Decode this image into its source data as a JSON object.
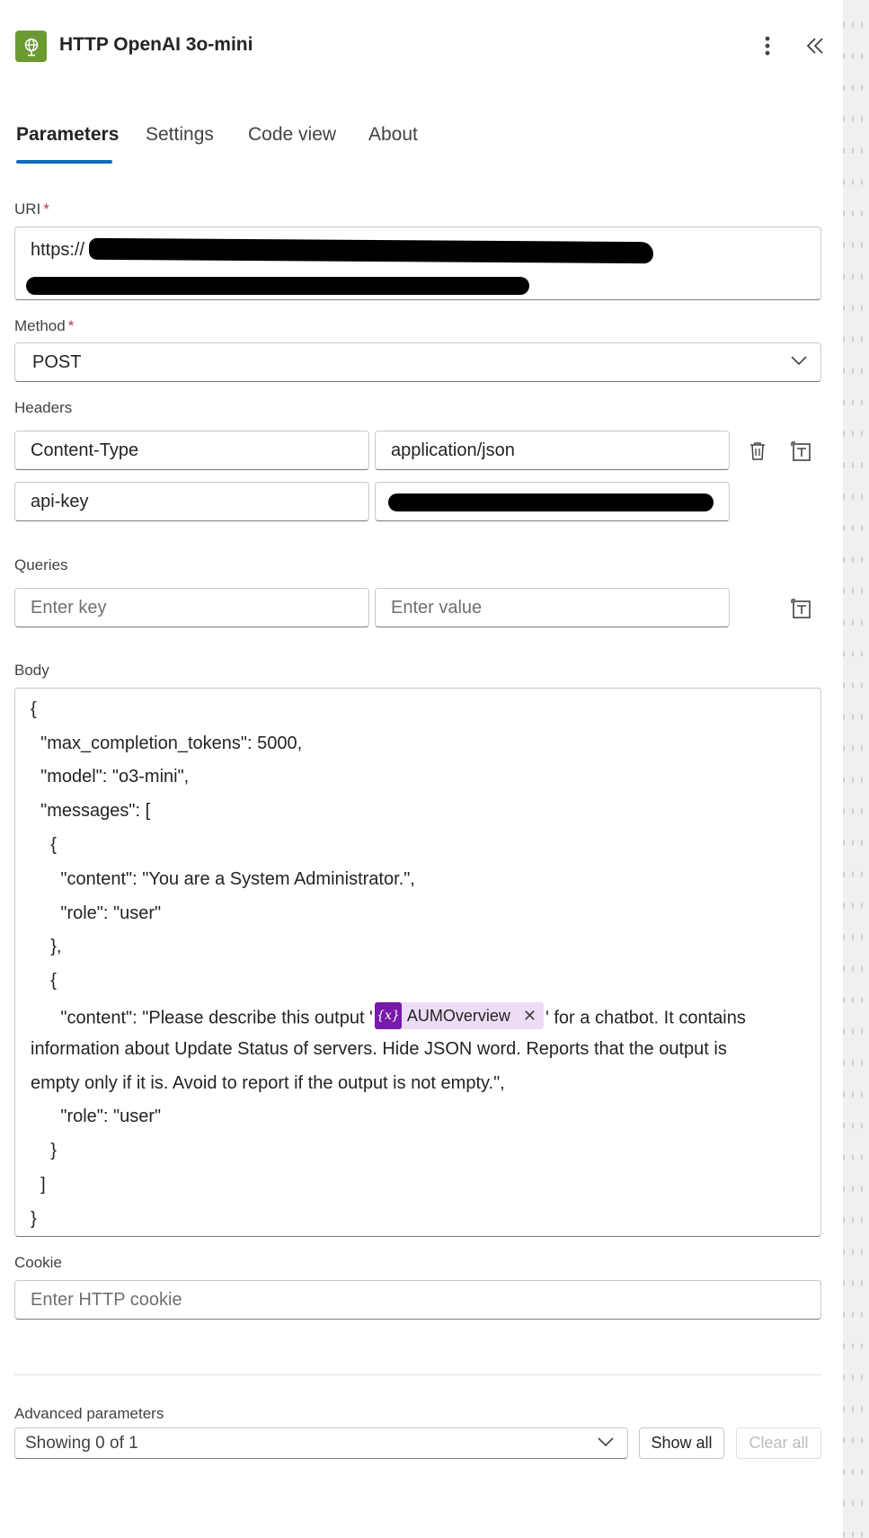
{
  "header": {
    "title": "HTTP OpenAI 3o-mini",
    "app_icon": "globe-icon",
    "app_icon_color": "#6b9a32"
  },
  "tabs": [
    {
      "label": "Parameters",
      "active": true
    },
    {
      "label": "Settings",
      "active": false
    },
    {
      "label": "Code view",
      "active": false
    },
    {
      "label": "About",
      "active": false
    }
  ],
  "uri": {
    "label": "URI",
    "required": "*",
    "value_visible_start": "https://"
  },
  "method": {
    "label": "Method",
    "required": "*",
    "value": "POST"
  },
  "headers": {
    "label": "Headers",
    "rows": [
      {
        "key": "Content-Type",
        "value": "application/json"
      },
      {
        "key": "api-key",
        "value": ""
      }
    ]
  },
  "queries": {
    "label": "Queries",
    "key_placeholder": "Enter key",
    "value_placeholder": "Enter value"
  },
  "body": {
    "label": "Body",
    "lines": [
      "{",
      "  \"max_completion_tokens\": 5000,",
      "  \"model\": \"o3-mini\",",
      "  \"messages\": [",
      "    {",
      "      \"content\": \"You are a System Administrator.\",",
      "      \"role\": \"user\"",
      "    },",
      "    {"
    ],
    "content_prefix": "      \"content\": \"Please describe this output '",
    "token_label": "AUMOverview",
    "content_suffix": "' for a chatbot. It contains",
    "content_wrap_1": "information about Update Status of servers. Hide JSON word. Reports that the output is",
    "content_wrap_2": "empty only if it is. Avoid to report if the output is not empty.\",",
    "tail_lines": [
      "      \"role\": \"user\"",
      "    }",
      "  ]",
      "}"
    ],
    "token_color": "#7719aa"
  },
  "cookie": {
    "label": "Cookie",
    "placeholder": "Enter HTTP cookie"
  },
  "advanced": {
    "label": "Advanced parameters",
    "select_value": "Showing 0 of 1",
    "show_all": "Show all",
    "clear_all": "Clear all"
  },
  "colors": {
    "accent": "#0f6cbd",
    "required": "#c4314b"
  }
}
